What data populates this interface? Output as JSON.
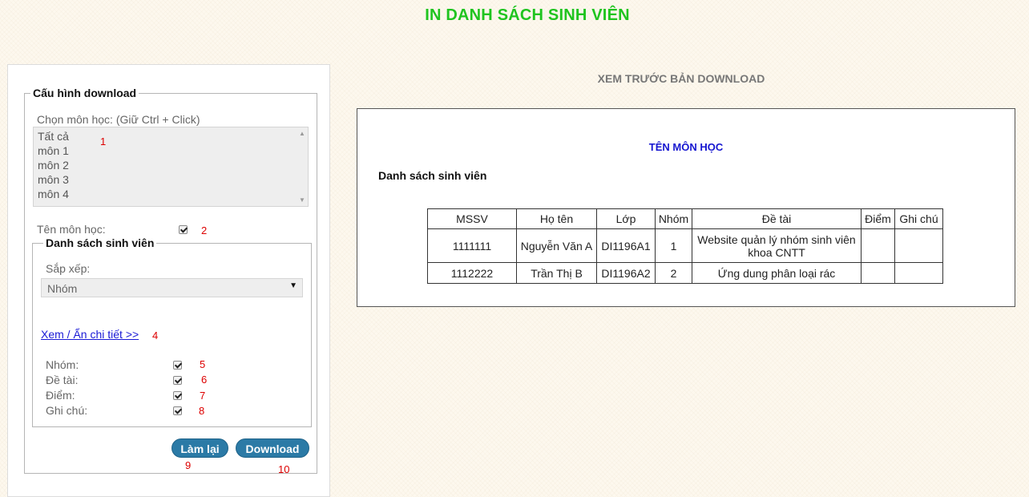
{
  "page_title": "IN DANH SÁCH SINH VIÊN",
  "config": {
    "legend": "Cấu hình download",
    "subject_label": "Chọn môn học: (Giữ Ctrl + Click)",
    "subjects": [
      "Tất cả",
      "môn 1",
      "môn 2",
      "môn 3",
      "môn 4"
    ],
    "course_name_label": "Tên môn học:",
    "course_name_checked": true,
    "student_list": {
      "legend": "Danh sách sinh viên",
      "sort_label": "Sắp xếp:",
      "sort_value": "Nhóm",
      "detail_link": "Xem / Ẩn chi tiết >>",
      "options": [
        {
          "label": "Nhóm:",
          "checked": true
        },
        {
          "label": "Đề tài:",
          "checked": true
        },
        {
          "label": "Điểm:",
          "checked": true
        },
        {
          "label": "Ghi chú:",
          "checked": true
        }
      ]
    },
    "reset_button": "Làm lại",
    "download_button": "Download"
  },
  "annotations": [
    "1",
    "2",
    "4",
    "5",
    "6",
    "7",
    "8",
    "9",
    "10"
  ],
  "preview": {
    "title": "XEM TRƯỚC BẢN DOWNLOAD",
    "course_name": "TÊN MÔN HỌC",
    "list_heading": "Danh sách sinh viên",
    "columns": [
      "MSSV",
      "Họ tên",
      "Lớp",
      "Nhóm",
      "Đề tài",
      "Điểm",
      "Ghi chú"
    ],
    "rows": [
      [
        "1111111",
        "Nguyễn Văn A",
        "DI1196A1",
        "1",
        "Website quản lý nhóm sinh viên khoa CNTT",
        "",
        ""
      ],
      [
        "1112222",
        "Trần Thị B",
        "DI1196A2",
        "2",
        "Ứng dung phân loại rác",
        "",
        ""
      ]
    ]
  }
}
